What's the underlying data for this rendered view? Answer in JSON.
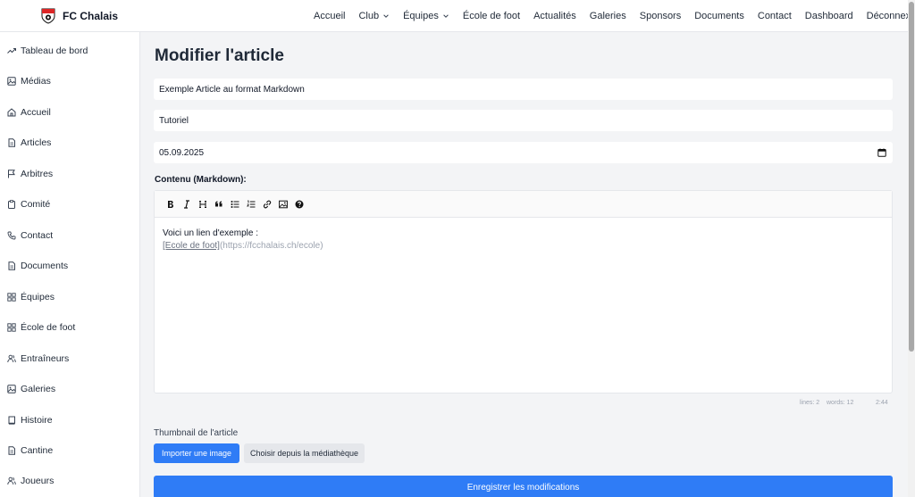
{
  "brand": {
    "name": "FC Chalais"
  },
  "nav": {
    "items": [
      "Accueil",
      "Club",
      "Équipes",
      "École de foot",
      "Actualités",
      "Galeries",
      "Sponsors",
      "Documents",
      "Contact",
      "Dashboard",
      "Déconnexion"
    ]
  },
  "sidebar": {
    "items": [
      {
        "label": "Tableau de bord",
        "icon": "trend-icon"
      },
      {
        "label": "Médias",
        "icon": "image-icon"
      },
      {
        "label": "Accueil",
        "icon": "home-icon"
      },
      {
        "label": "Articles",
        "icon": "file-icon"
      },
      {
        "label": "Arbitres",
        "icon": "flag-icon"
      },
      {
        "label": "Comité",
        "icon": "clipboard-icon"
      },
      {
        "label": "Contact",
        "icon": "phone-icon"
      },
      {
        "label": "Documents",
        "icon": "file-icon"
      },
      {
        "label": "Équipes",
        "icon": "grid-icon"
      },
      {
        "label": "École de foot",
        "icon": "grid-icon"
      },
      {
        "label": "Entraîneurs",
        "icon": "users-icon"
      },
      {
        "label": "Galeries",
        "icon": "image-icon"
      },
      {
        "label": "Histoire",
        "icon": "book-icon"
      },
      {
        "label": "Cantine",
        "icon": "file-icon"
      },
      {
        "label": "Joueurs",
        "icon": "users-icon"
      }
    ]
  },
  "main": {
    "title": "Modifier l'article",
    "title_field": "Exemple Article au format Markdown",
    "category_field": "Tutoriel",
    "date_field": "05.09.2025",
    "content_label": "Contenu (Markdown):",
    "editor": {
      "line1": "Voici un lien d'exemple :",
      "link_text": "[Ecole de foot]",
      "link_url": "(https://fcchalais.ch/ecole)",
      "status_lines": "lines: 2",
      "status_words": "words: 12",
      "status_cursor": "2:44"
    },
    "thumbnail_label": "Thumbnail de l'article",
    "import_button": "Importer une image",
    "library_button": "Choisir depuis la médiathèque",
    "save_button": "Enregistrer les modifications"
  },
  "colors": {
    "primary": "#2f7cf6",
    "background": "#f3f4f6",
    "brand_red": "#dc2626"
  }
}
